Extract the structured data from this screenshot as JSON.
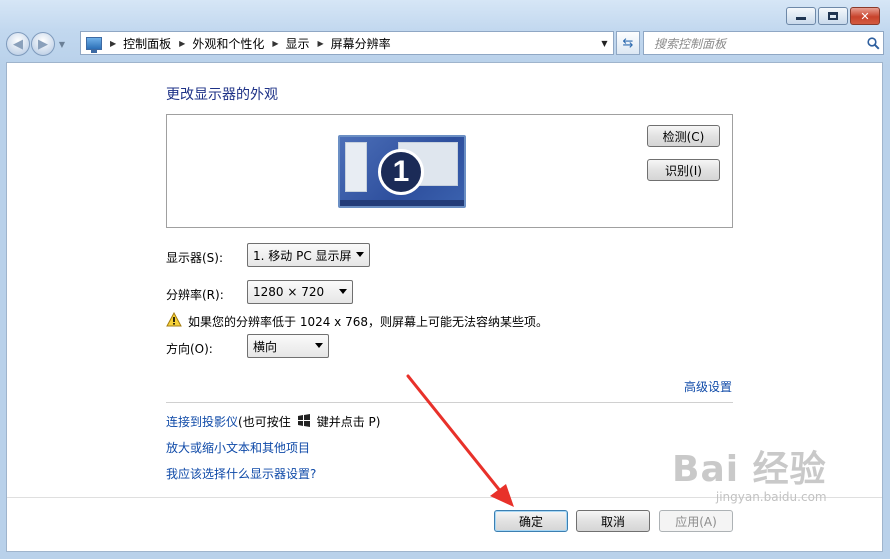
{
  "window": {
    "caption_buttons": {
      "minimize_icon": "minimize-icon",
      "maximize_icon": "maximize-icon",
      "close_icon": "close-icon"
    }
  },
  "navbar": {
    "back_icon": "back-arrow-icon",
    "forward_icon": "forward-arrow-icon",
    "breadcrumbs": [
      "控制面板",
      "外观和个性化",
      "显示",
      "屏幕分辨率"
    ],
    "search_placeholder": "搜索控制面板"
  },
  "main": {
    "title": "更改显示器的外观",
    "monitor_number": "1",
    "detect_label": "检测(C)",
    "identify_label": "识别(I)",
    "display_label": "显示器(S):",
    "display_value": "1. 移动 PC 显示屏",
    "resolution_label": "分辨率(R):",
    "resolution_value": "1280 × 720",
    "warning_text": "如果您的分辨率低于 1024 x 768，则屏幕上可能无法容纳某些项。",
    "orientation_label": "方向(O):",
    "orientation_value": "横向",
    "advanced_link": "高级设置",
    "projector_link": "连接到投影仪",
    "projector_hint_prefix": " (也可按住 ",
    "projector_hint_suffix": " 键并点击 P)",
    "text_size_link": "放大或缩小文本和其他项目",
    "which_settings_link": "我应该选择什么显示器设置?"
  },
  "footer": {
    "ok_label": "确定",
    "cancel_label": "取消",
    "apply_label": "应用(A)"
  },
  "watermark": {
    "brand": "Bai 经验",
    "url": "jingyan.baidu.com"
  },
  "colors": {
    "link": "#0f4aa8",
    "title": "#1e3287",
    "arrow": "#e8312a"
  }
}
